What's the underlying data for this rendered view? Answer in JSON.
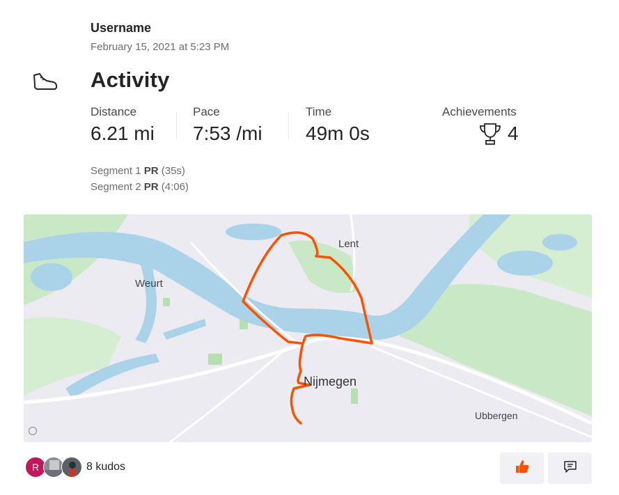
{
  "header": {
    "username": "Username",
    "datetime": "February 15, 2021 at 5:23 PM",
    "activity_type_icon": "running-shoe-icon",
    "title": "Activity"
  },
  "stats": [
    {
      "label": "Distance",
      "value": "6.21 mi"
    },
    {
      "label": "Pace",
      "value": "7:53 /mi"
    },
    {
      "label": "Time",
      "value": "49m 0s"
    }
  ],
  "achievements": {
    "label": "Achievements",
    "icon": "trophy-icon",
    "count": "4"
  },
  "segments": [
    {
      "name": "Segment 1",
      "badge": "PR",
      "time": "(35s)"
    },
    {
      "name": "Segment 2",
      "badge": "PR",
      "time": "(4:06)"
    }
  ],
  "map": {
    "labels": {
      "lent": "Lent",
      "weurt": "Weurt",
      "nijmegen": "Nijmegen",
      "ubbergen": "Ubbergen"
    },
    "route_color": "#fc5200",
    "water_color": "#aad3ea",
    "land_color": "#ecebf1",
    "green_color": "#c9e8c5"
  },
  "kudos": {
    "count_text": "8 kudos",
    "avatars": [
      {
        "initial": "R",
        "color": "#c2185b"
      },
      {
        "initial": "",
        "color": "#8a8f96"
      },
      {
        "initial": "",
        "color": "#5c6168"
      }
    ]
  },
  "actions": {
    "kudos_button_icon": "thumbs-up-icon",
    "comment_button_icon": "comment-icon",
    "accent": "#fc5200"
  }
}
